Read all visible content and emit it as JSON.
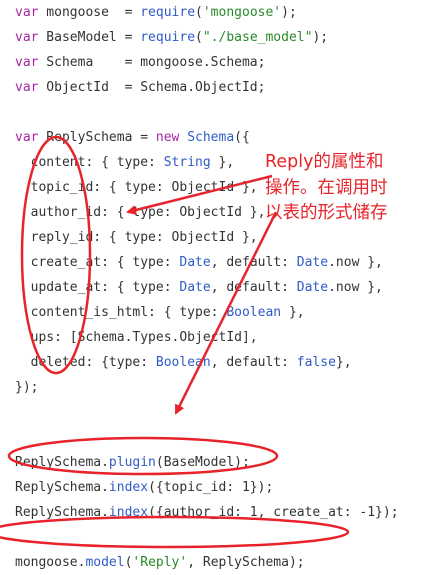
{
  "code": {
    "lines": [
      {
        "segs": [
          {
            "t": "var",
            "c": "kw"
          },
          {
            "t": " mongoose  = "
          },
          {
            "t": "require",
            "c": "fn"
          },
          {
            "t": "("
          },
          {
            "t": "'mongoose'",
            "c": "str"
          },
          {
            "t": ");"
          }
        ]
      },
      {
        "segs": [
          {
            "t": "var",
            "c": "kw"
          },
          {
            "t": " BaseModel = "
          },
          {
            "t": "require",
            "c": "fn"
          },
          {
            "t": "("
          },
          {
            "t": "\"./base_model\"",
            "c": "str"
          },
          {
            "t": ");"
          }
        ]
      },
      {
        "segs": [
          {
            "t": "var",
            "c": "kw"
          },
          {
            "t": " Schema    = mongoose.Schema;"
          }
        ]
      },
      {
        "segs": [
          {
            "t": "var",
            "c": "kw"
          },
          {
            "t": " ObjectId  = Schema.ObjectId;"
          }
        ]
      },
      {
        "segs": []
      },
      {
        "segs": [
          {
            "t": "var",
            "c": "kw"
          },
          {
            "t": " ReplySchema = "
          },
          {
            "t": "new",
            "c": "kw"
          },
          {
            "t": " "
          },
          {
            "t": "Schema",
            "c": "fn"
          },
          {
            "t": "({"
          }
        ]
      },
      {
        "segs": [
          {
            "t": "  content: { type: "
          },
          {
            "t": "String",
            "c": "ty"
          },
          {
            "t": " },"
          }
        ]
      },
      {
        "segs": [
          {
            "t": "  topic_id: { type: ObjectId },"
          }
        ]
      },
      {
        "segs": [
          {
            "t": "  author_id: { type: ObjectId },"
          }
        ]
      },
      {
        "segs": [
          {
            "t": "  reply_id: { type: ObjectId },"
          }
        ]
      },
      {
        "segs": [
          {
            "t": "  create_at: { type: "
          },
          {
            "t": "Date",
            "c": "ty"
          },
          {
            "t": ", default: "
          },
          {
            "t": "Date",
            "c": "ty"
          },
          {
            "t": ".now },"
          }
        ]
      },
      {
        "segs": [
          {
            "t": "  update_at: { type: "
          },
          {
            "t": "Date",
            "c": "ty"
          },
          {
            "t": ", default: "
          },
          {
            "t": "Date",
            "c": "ty"
          },
          {
            "t": ".now },"
          }
        ]
      },
      {
        "segs": [
          {
            "t": "  content_is_html: { type: "
          },
          {
            "t": "Boolean",
            "c": "ty"
          },
          {
            "t": " },"
          }
        ]
      },
      {
        "segs": [
          {
            "t": "  ups: [Schema.Types.ObjectId],"
          }
        ]
      },
      {
        "segs": [
          {
            "t": "  deleted: {type: "
          },
          {
            "t": "Boolean",
            "c": "ty"
          },
          {
            "t": ", default: "
          },
          {
            "t": "false",
            "c": "ty"
          },
          {
            "t": "},"
          }
        ]
      },
      {
        "segs": [
          {
            "t": "});"
          }
        ]
      },
      {
        "segs": []
      },
      {
        "segs": []
      },
      {
        "segs": [
          {
            "t": "ReplySchema."
          },
          {
            "t": "plugin",
            "c": "fn"
          },
          {
            "t": "(BaseModel);"
          }
        ]
      },
      {
        "segs": [
          {
            "t": "ReplySchema."
          },
          {
            "t": "index",
            "c": "fn"
          },
          {
            "t": "({topic_id: 1});"
          }
        ]
      },
      {
        "segs": [
          {
            "t": "ReplySchema."
          },
          {
            "t": "index",
            "c": "fn"
          },
          {
            "t": "({author_id: 1, create_at: -1});"
          }
        ]
      },
      {
        "segs": []
      },
      {
        "segs": [
          {
            "t": "mongoose."
          },
          {
            "t": "model",
            "c": "fn"
          },
          {
            "t": "("
          },
          {
            "t": "'Reply'",
            "c": "str"
          },
          {
            "t": ", ReplySchema);"
          }
        ]
      }
    ]
  },
  "annotation": {
    "lines": [
      "Reply的属性和",
      "操作。在调用时",
      "以表的形式储存"
    ]
  },
  "colors": {
    "annotation": "#e8232a",
    "keyword": "#a626a4",
    "function": "#2f5bc7",
    "string": "#2a8a2a",
    "text": "#333333"
  }
}
